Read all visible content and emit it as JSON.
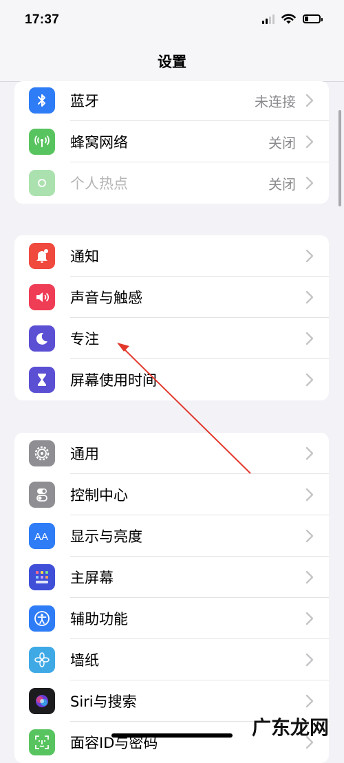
{
  "status_bar": {
    "time": "17:37",
    "battery_level": 0.25
  },
  "nav": {
    "title": "设置"
  },
  "colors": {
    "accent_red_arrow": "#e2382b",
    "chevron": "#c4c4c7"
  },
  "group1": [
    {
      "label": "蓝牙",
      "value": "未连接",
      "icon": "bluetooth-icon",
      "icon_color": "#2e7cf6"
    },
    {
      "label": "蜂窝网络",
      "value": "关闭",
      "icon": "antenna-icon",
      "icon_color": "#58c45f"
    },
    {
      "label": "个人热点",
      "value": "关闭",
      "icon": "hotspot-icon",
      "icon_color": "#58c45f"
    }
  ],
  "group2": [
    {
      "label": "通知",
      "icon": "bell-icon",
      "icon_color": "#f0493e"
    },
    {
      "label": "声音与触感",
      "icon": "speaker-icon",
      "icon_color": "#f03d56"
    },
    {
      "label": "专注",
      "icon": "moon-icon",
      "icon_color": "#5b4fd4"
    },
    {
      "label": "屏幕使用时间",
      "icon": "hourglass-icon",
      "icon_color": "#5b4fd4"
    }
  ],
  "group3": [
    {
      "label": "通用",
      "icon": "gear-icon",
      "icon_color": "#8e8e93"
    },
    {
      "label": "控制中心",
      "icon": "toggles-icon",
      "icon_color": "#8e8e93"
    },
    {
      "label": "显示与亮度",
      "icon": "text-size-icon",
      "icon_color": "#2e7cf6"
    },
    {
      "label": "主屏幕",
      "icon": "home-grid-icon",
      "icon_color": "#3f4fd8"
    },
    {
      "label": "辅助功能",
      "icon": "accessibility-icon",
      "icon_color": "#2e7cf6"
    },
    {
      "label": "墙纸",
      "icon": "flower-icon",
      "icon_color": "#3fa9e6"
    },
    {
      "label": "Siri与搜索",
      "icon": "siri-icon",
      "icon_color": "#222"
    },
    {
      "label": "面容ID与密码",
      "icon": "face-id-icon",
      "icon_color": "#58c45f"
    }
  ],
  "watermark": {
    "text": "广东龙网"
  }
}
